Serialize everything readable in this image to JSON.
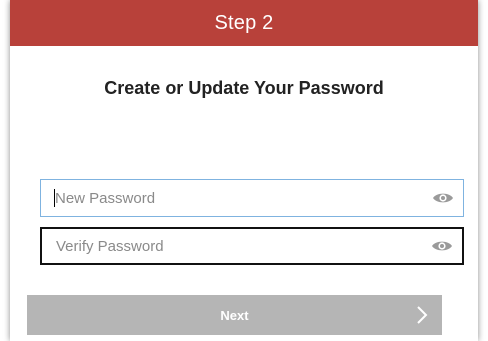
{
  "header": {
    "title": "Step 2",
    "color": "#b8413a"
  },
  "main": {
    "title": "Create or Update Your Password"
  },
  "fields": {
    "new_password": {
      "placeholder": "New Password",
      "value": ""
    },
    "verify_password": {
      "placeholder": "Verify Password",
      "value": ""
    }
  },
  "icons": {
    "reveal": "eye-icon",
    "next": "chevron-right-icon"
  },
  "actions": {
    "next_label": "Next",
    "next_color": "#b5b5b5"
  }
}
